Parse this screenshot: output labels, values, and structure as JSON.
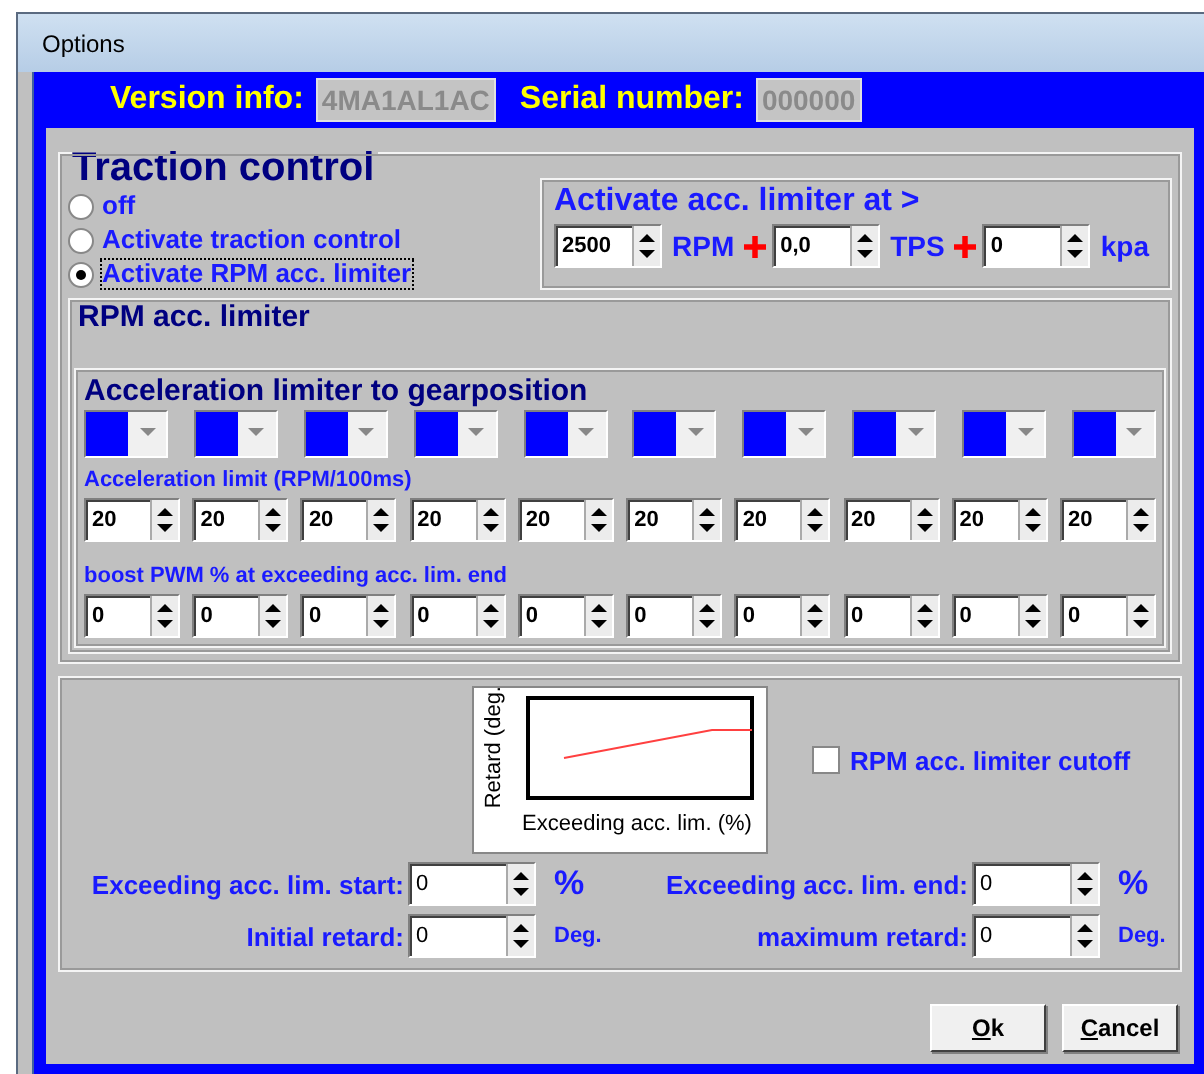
{
  "window": {
    "title": "Options"
  },
  "header": {
    "version_label": "Version info:",
    "version_value": "4MA1AL1AC",
    "serial_label": "Serial number:",
    "serial_value": "000000"
  },
  "traction_control": {
    "title": "Traction control",
    "modes": [
      {
        "label": "off",
        "selected": false
      },
      {
        "label": "Activate traction control",
        "selected": false
      },
      {
        "label": "Activate RPM acc. limiter",
        "selected": true
      }
    ],
    "activate_at": {
      "title": "Activate acc. limiter at >",
      "inputs": [
        {
          "value": "2500",
          "unit": "RPM"
        },
        {
          "value": "0,0",
          "unit": "TPS"
        },
        {
          "value": "0",
          "unit": "kpa"
        }
      ]
    },
    "rpm_limiter": {
      "title": "RPM acc. limiter",
      "gear_title": "Acceleration limiter to gearposition",
      "gear_selectors": [
        {
          "color": "#0000ff"
        },
        {
          "color": "#0000ff"
        },
        {
          "color": "#0000ff"
        },
        {
          "color": "#0000ff"
        },
        {
          "color": "#0000ff"
        },
        {
          "color": "#0000ff"
        },
        {
          "color": "#0000ff"
        },
        {
          "color": "#0000ff"
        },
        {
          "color": "#0000ff"
        },
        {
          "color": "#0000ff"
        }
      ],
      "accel_limit_label": "Acceleration limit (RPM/100ms)",
      "accel_limits": [
        "20",
        "20",
        "20",
        "20",
        "20",
        "20",
        "20",
        "20",
        "20",
        "20"
      ],
      "boost_label": "boost PWM % at exceeding acc. lim. end",
      "boost_values": [
        "0",
        "0",
        "0",
        "0",
        "0",
        "0",
        "0",
        "0",
        "0",
        "0"
      ]
    }
  },
  "retard": {
    "chart": {
      "ylabel": "Retard (deg.",
      "xlabel": "Exceeding acc. lim. (%)"
    },
    "cutoff": {
      "label": "RPM acc. limiter cutoff",
      "checked": false
    },
    "fields": [
      {
        "label": "Exceeding acc. lim. start:",
        "value": "0",
        "unit": "%"
      },
      {
        "label": "Exceeding acc. lim. end:",
        "value": "0",
        "unit": "%"
      },
      {
        "label": "Initial retard:",
        "value": "0",
        "unit": "Deg."
      },
      {
        "label": "maximum retard:",
        "value": "0",
        "unit": "Deg."
      }
    ]
  },
  "buttons": [
    {
      "label": "Ok"
    },
    {
      "label": "Cancel"
    }
  ]
}
